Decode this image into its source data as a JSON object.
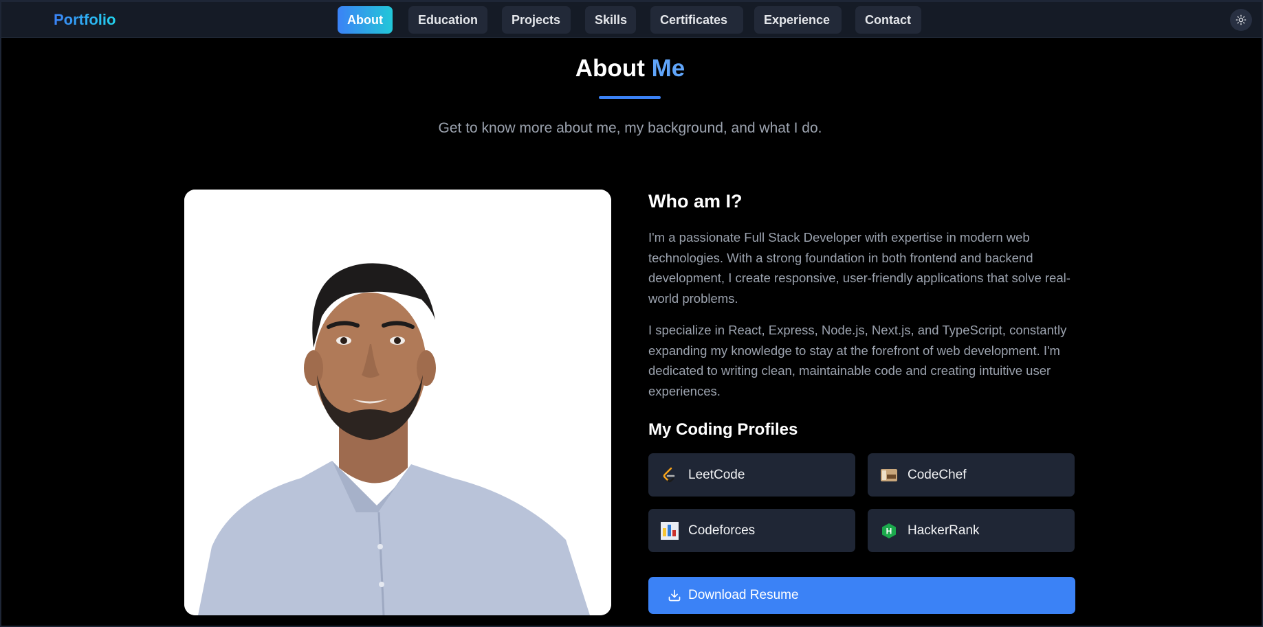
{
  "navbar": {
    "brand": "Portfolio",
    "tabs": [
      {
        "label": "About",
        "active": true
      },
      {
        "label": "Education",
        "active": false
      },
      {
        "label": "Projects",
        "active": false
      },
      {
        "label": "Skills",
        "active": false
      },
      {
        "label": "Certificates",
        "active": false
      },
      {
        "label": "Experience",
        "active": false
      },
      {
        "label": "Contact",
        "active": false
      }
    ],
    "theme_icon": "sun-icon"
  },
  "header": {
    "title_main": "About",
    "title_accent": "Me",
    "subtitle": "Get to know more about me, my background, and what I do."
  },
  "about": {
    "heading": "Who am I?",
    "paragraphs": [
      "I'm a passionate Full Stack Developer with expertise in modern web technologies. With a strong foundation in both frontend and backend development, I create responsive, user-friendly applications that solve real-world problems.",
      "I specialize in React, Express, Node.js, Next.js, and TypeScript, constantly expanding my knowledge to stay at the forefront of web development. I'm dedicated to writing clean, maintainable code and creating intuitive user experiences."
    ],
    "profiles_heading": "My Coding Profiles",
    "profiles": [
      {
        "label": "LeetCode",
        "icon": "leetcode-icon"
      },
      {
        "label": "CodeChef",
        "icon": "codechef-icon"
      },
      {
        "label": "Codeforces",
        "icon": "codeforces-icon"
      },
      {
        "label": "HackerRank",
        "icon": "hackerrank-icon"
      }
    ],
    "download_label": "Download Resume",
    "download_icon": "download-icon"
  },
  "colors": {
    "accent": "#3b82f6",
    "background": "#000000",
    "navbar": "#151b26",
    "card": "#1f2635"
  }
}
